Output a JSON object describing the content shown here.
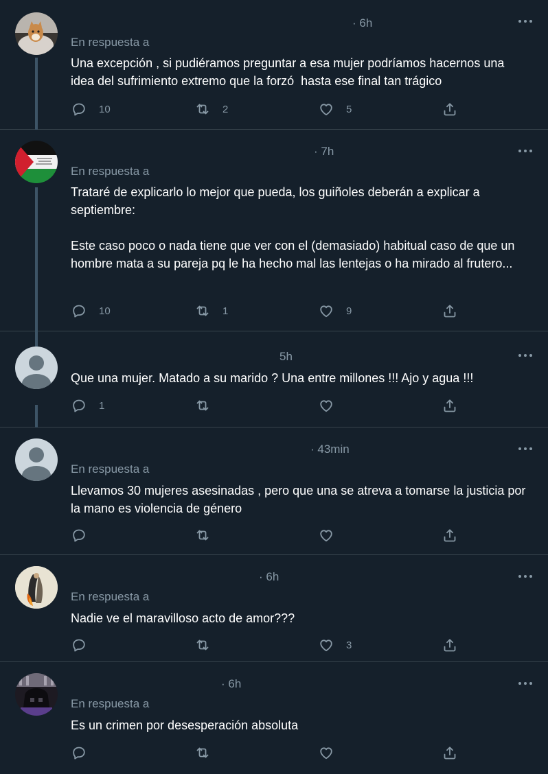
{
  "colors": {
    "background": "#15202b",
    "divider": "#38444d",
    "secondary_text": "#8899a6",
    "primary_text": "#ffffff"
  },
  "tweets": [
    {
      "avatar": "kitten-photo",
      "time": "· 6h",
      "reply_to": "En respuesta a",
      "text": "Una excepción , si pudiéramos preguntar a esa mujer podríamos hacernos una idea del sufrimiento extremo que la forzó  hasta ese final tan trágico",
      "replies": "10",
      "retweets": "2",
      "likes": "5"
    },
    {
      "avatar": "palestine-flag",
      "time": "· 7h",
      "reply_to": "En respuesta a",
      "text": "Trataré de explicarlo lo mejor que pueda, los guiñoles deberán a explicar a septiembre:\n\nEste caso poco o nada tiene que ver con el (demasiado) habitual caso de que un hombre mata a su pareja pq le ha hecho mal las lentejas o ha mirado al frutero...",
      "replies": "10",
      "retweets": "1",
      "likes": "9"
    },
    {
      "avatar": "default-avatar",
      "time": "5h",
      "reply_to": "",
      "text": "Que una mujer. Matado a su marido ? Una entre millones !!! Ajo y agua !!!",
      "replies": "1",
      "retweets": "",
      "likes": ""
    },
    {
      "avatar": "default-avatar",
      "time": "· 43min",
      "reply_to": "En respuesta a",
      "text": "Llevamos 30 mujeres asesinadas , pero que una se atreva a tomarse la justicia por la mano es violencia de género",
      "replies": "",
      "retweets": "",
      "likes": ""
    },
    {
      "avatar": "artwork-avatar",
      "time": "· 6h",
      "reply_to": "En respuesta a",
      "text": "Nadie ve el maravilloso acto de amor???",
      "replies": "",
      "retweets": "",
      "likes": "3"
    },
    {
      "avatar": "dark-helmet-avatar",
      "time": "· 6h",
      "reply_to": "En respuesta a",
      "text": "Es un crimen por desesperación absoluta",
      "replies": "",
      "retweets": "",
      "likes": ""
    }
  ]
}
